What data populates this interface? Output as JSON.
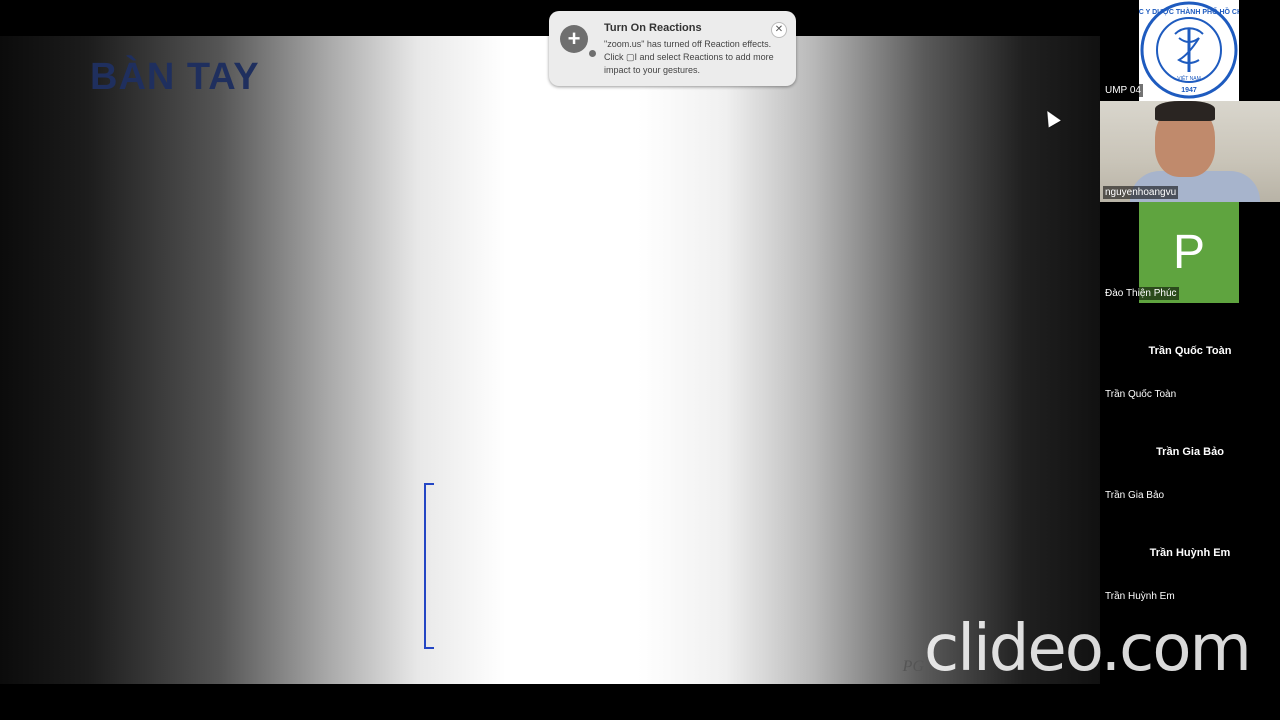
{
  "slide": {
    "title": "BÀN TAY",
    "footer": "PG"
  },
  "notification": {
    "title": "Turn On Reactions",
    "body": "\"zoom.us\" has turned off Reaction effects. Click ▢I and select Reactions to add more impact to your gestures.",
    "icon": "plus-icon",
    "close_icon": "close-icon"
  },
  "participants": [
    {
      "name": "UMP 04",
      "type": "logo",
      "logo_icon": "university-seal-icon",
      "logo_text": "ĐẠI HỌC Y DƯỢC THÀNH PHỐ HỒ CHÍ MINH",
      "logo_sub": "VIỆT NAM",
      "logo_year": "1947"
    },
    {
      "name": "nguyenhoangvu",
      "type": "video"
    },
    {
      "name": "Đào Thiện Phúc",
      "type": "avatar",
      "avatar_letter": "P",
      "avatar_color": "#5fa43f"
    },
    {
      "name": "Trần Quốc Toàn",
      "type": "text",
      "center_label": "Trần Quốc Toàn"
    },
    {
      "name": "Trần Gia Bảo",
      "type": "text",
      "center_label": "Trần Gia Bảo"
    },
    {
      "name": "Trần Huỳnh Em",
      "type": "text",
      "center_label": "Trần Huỳnh Em"
    }
  ],
  "watermark": "clideo.com"
}
